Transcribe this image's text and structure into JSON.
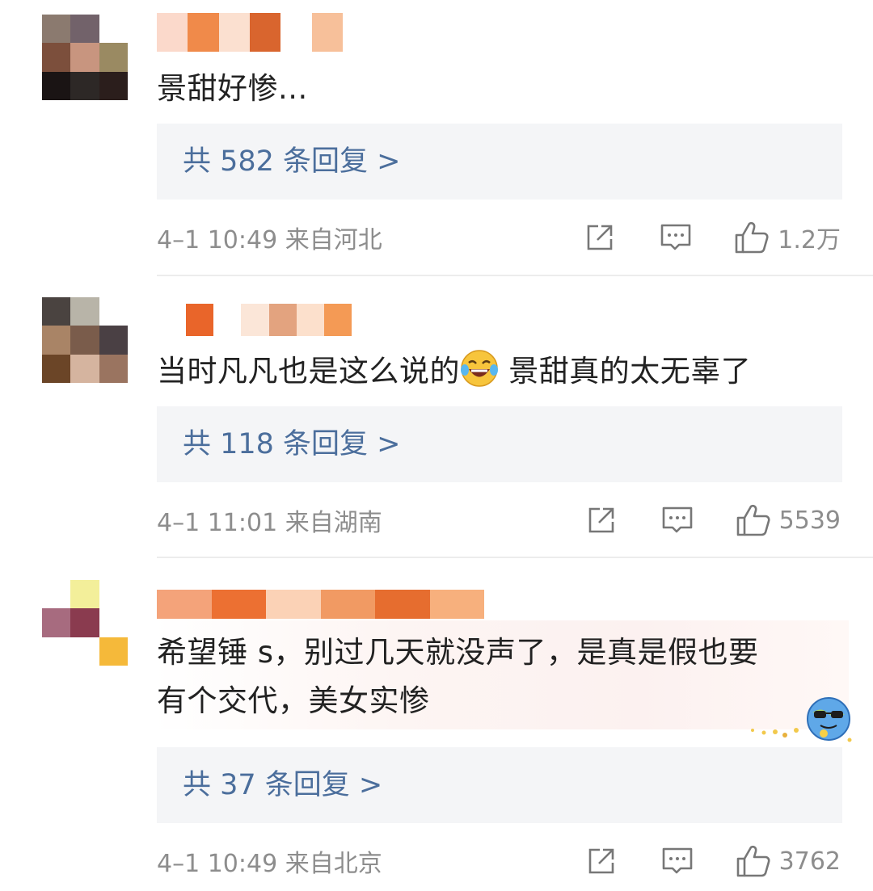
{
  "comments": [
    {
      "text": "景甜好惨...",
      "reply_label": "共 582 条回复 >",
      "time_location": "4–1 10:49  来自河北",
      "likes": "1.2万",
      "avatar_colors": [
        "#8b7a6f",
        "#72626a",
        "#ffffff",
        "#7c4f3c",
        "#c8957f",
        "#9a8a62",
        "#1a1414",
        "#2d2826",
        "#2b1e1c"
      ],
      "name_colors": [
        "#fbd9cb",
        "#f08a4a",
        "#fbe0d0",
        "#d9652e",
        "#ffffff",
        "#f7c09a"
      ]
    },
    {
      "text_before_emoji": "当时凡凡也是这么说的",
      "emoji": "😂",
      "text_after_emoji": " 景甜真的太无辜了",
      "reply_label": "共 118 条回复 >",
      "time_location": "4–1 11:01  来自湖南",
      "likes": "5539",
      "avatar_colors": [
        "#4a4340",
        "#b8b4a8",
        "#ffffff",
        "#a98466",
        "#7a5c4b",
        "#4a4044",
        "#6b4527",
        "#d5b49f",
        "#9a7460"
      ],
      "name_colors": [
        "#e9652a",
        "#ffffff",
        "#fbe6d8",
        "#e3a37f",
        "#fce0cc",
        "#f49a55"
      ]
    },
    {
      "text_line1": "希望锤 s，别过几天就没声了，是真是假也要",
      "text_line2": "有个交代，美女实惨",
      "reply_label": "共 37 条回复 >",
      "time_location": "4–1 10:49  来自北京",
      "likes": "3762",
      "avatar_colors": [
        "#ffffff",
        "#f3ef9a",
        "#ffffff",
        "#a76b7f",
        "#8a3b4f",
        "#ffffff",
        "#ffffff",
        "#ffffff",
        "#f5b93a"
      ],
      "name_colors": [
        "#f4a37a",
        "#ec7032",
        "#fbd2b6",
        "#f19a63",
        "#e66d2f",
        "#f7b07d"
      ]
    }
  ]
}
